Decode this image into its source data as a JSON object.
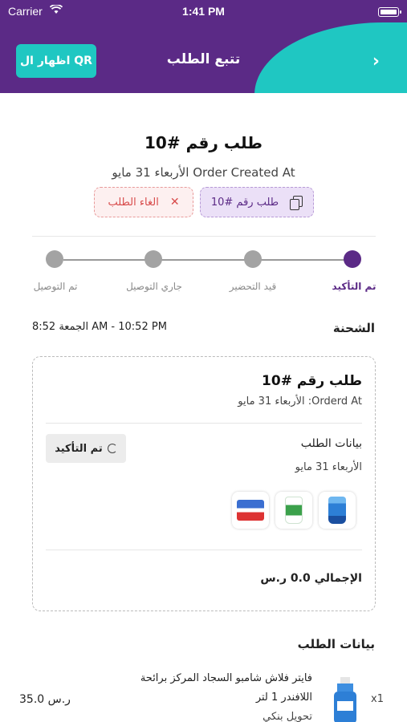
{
  "status_bar": {
    "carrier": "Carrier",
    "time": "1:41 PM"
  },
  "header": {
    "title": "تتبع الطلب",
    "qr_button": "اظهار ال QR",
    "back": "›"
  },
  "order": {
    "number": "طلب رقم #10",
    "created": "الأربعاء 31 مايو Order Created At",
    "copy_chip": "طلب رقم #10",
    "cancel_chip": "الغاء الطلب"
  },
  "steps": [
    {
      "label": "تم التأكيد",
      "active": true
    },
    {
      "label": "قيد التحضير",
      "active": false
    },
    {
      "label": "جاري التوصيل",
      "active": false
    },
    {
      "label": "تم التوصيل",
      "active": false
    }
  ],
  "shipment": {
    "title": "الشحنة",
    "time": "الجمعة 8:52 AM - 10:52 PM"
  },
  "card": {
    "order": "طلب رقم #10",
    "date": "الأربعاء 31 مايو :Orderd At",
    "details_label": "بيانات الطلب",
    "details_date": "الأربعاء 31 مايو",
    "status": "تم التأكيد",
    "total": "الإجمالي 0.0 ر.س"
  },
  "order_data": {
    "title": "بيانات الطلب",
    "items": [
      {
        "qty": "x1",
        "name": "فايتر فلاش شامبو السجاد المركز برائحة اللافندر 1 لتر",
        "sub": "تحويل بنكي",
        "price": "35.0 ر.س"
      }
    ]
  },
  "colors": {
    "primary": "#5b2a86",
    "accent": "#1fc7c2"
  }
}
